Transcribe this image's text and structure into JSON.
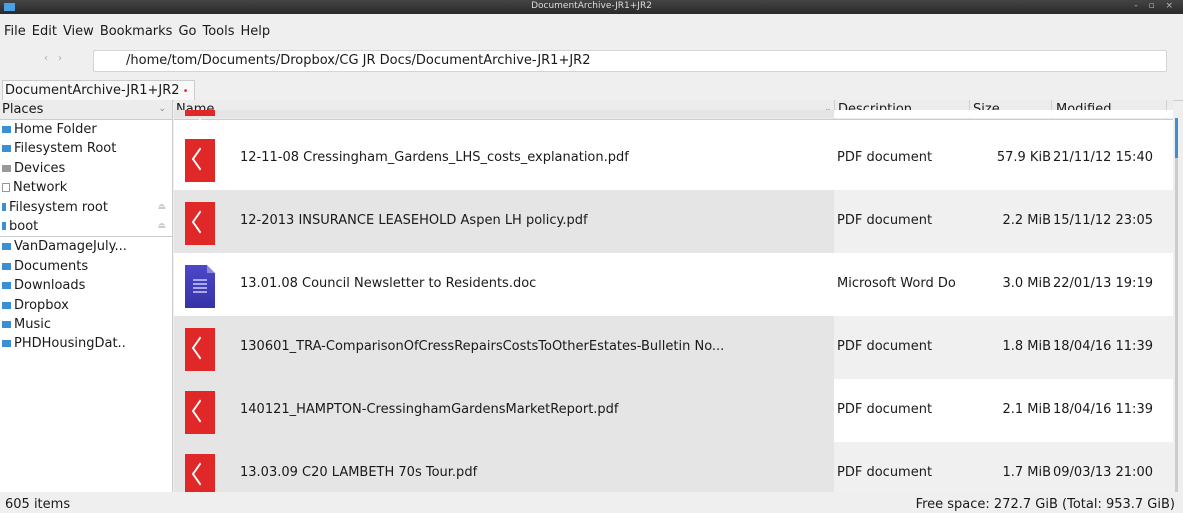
{
  "window": {
    "title": "DocumentArchive-JR1+JR2",
    "controls": "- ▫ ×"
  },
  "menu": [
    "File",
    "Edit",
    "View",
    "Bookmarks",
    "Go",
    "Tools",
    "Help"
  ],
  "nav": {
    "back": "‹",
    "forward": "›"
  },
  "path": "/home/tom/Documents/Dropbox/CG JR Docs/DocumentArchive-JR1+JR2",
  "tab": {
    "label": "DocumentArchive-JR1+JR2",
    "modified_marker": "•"
  },
  "sidebar": {
    "header": "Places",
    "items": [
      {
        "label": "Home Folder",
        "icon": "folder-icon"
      },
      {
        "label": "Filesystem Root",
        "icon": "folder-icon"
      },
      {
        "label": "Devices",
        "icon": "devices-icon"
      },
      {
        "label": "Network",
        "icon": "network-icon"
      },
      {
        "label": "Filesystem root",
        "icon": "drive-icon"
      },
      {
        "label": "boot",
        "icon": "drive-icon"
      },
      {
        "label": "VanDamageJuly...",
        "icon": "folder-icon"
      },
      {
        "label": "Documents",
        "icon": "folder-icon"
      },
      {
        "label": "Downloads",
        "icon": "folder-icon"
      },
      {
        "label": "Dropbox",
        "icon": "folder-icon"
      },
      {
        "label": "Music",
        "icon": "folder-icon"
      },
      {
        "label": "PHDHousingDat..",
        "icon": "folder-icon"
      }
    ]
  },
  "columns": {
    "name": "Name",
    "description": "Description",
    "size": "Size",
    "modified": "Modified"
  },
  "files": [
    {
      "name": "12-11-08 Cressingham_Gardens_LHS_costs_explanation.pdf",
      "type": "pdf",
      "description": "PDF document",
      "size": "57.9 KiB",
      "modified": "21/11/12 15:40"
    },
    {
      "name": "12-2013 INSURANCE LEASEHOLD Aspen LH policy.pdf",
      "type": "pdf",
      "description": "PDF document",
      "size": "2.2 MiB",
      "modified": "15/11/12 23:05"
    },
    {
      "name": "13.01.08 Council Newsletter to Residents.doc",
      "type": "doc",
      "description": "Microsoft Word Do",
      "size": "3.0 MiB",
      "modified": "22/01/13 19:19"
    },
    {
      "name": "130601_TRA-ComparisonOfCressRepairsCostsToOtherEstates-Bulletin No...",
      "type": "pdf",
      "description": "PDF document",
      "size": "1.8 MiB",
      "modified": "18/04/16 11:39"
    },
    {
      "name": "140121_HAMPTON-CressinghamGardensMarketReport.pdf",
      "type": "pdf",
      "description": "PDF document",
      "size": "2.1 MiB",
      "modified": "18/04/16 11:39"
    },
    {
      "name": "13.03.09 C20 LAMBETH 70s Tour.pdf",
      "type": "pdf",
      "description": "PDF document",
      "size": "1.7 MiB",
      "modified": "09/03/13 21:00"
    }
  ],
  "status": {
    "items": "605 items",
    "free_space": "Free space: 272.7 GiB (Total: 953.7 GiB)"
  }
}
